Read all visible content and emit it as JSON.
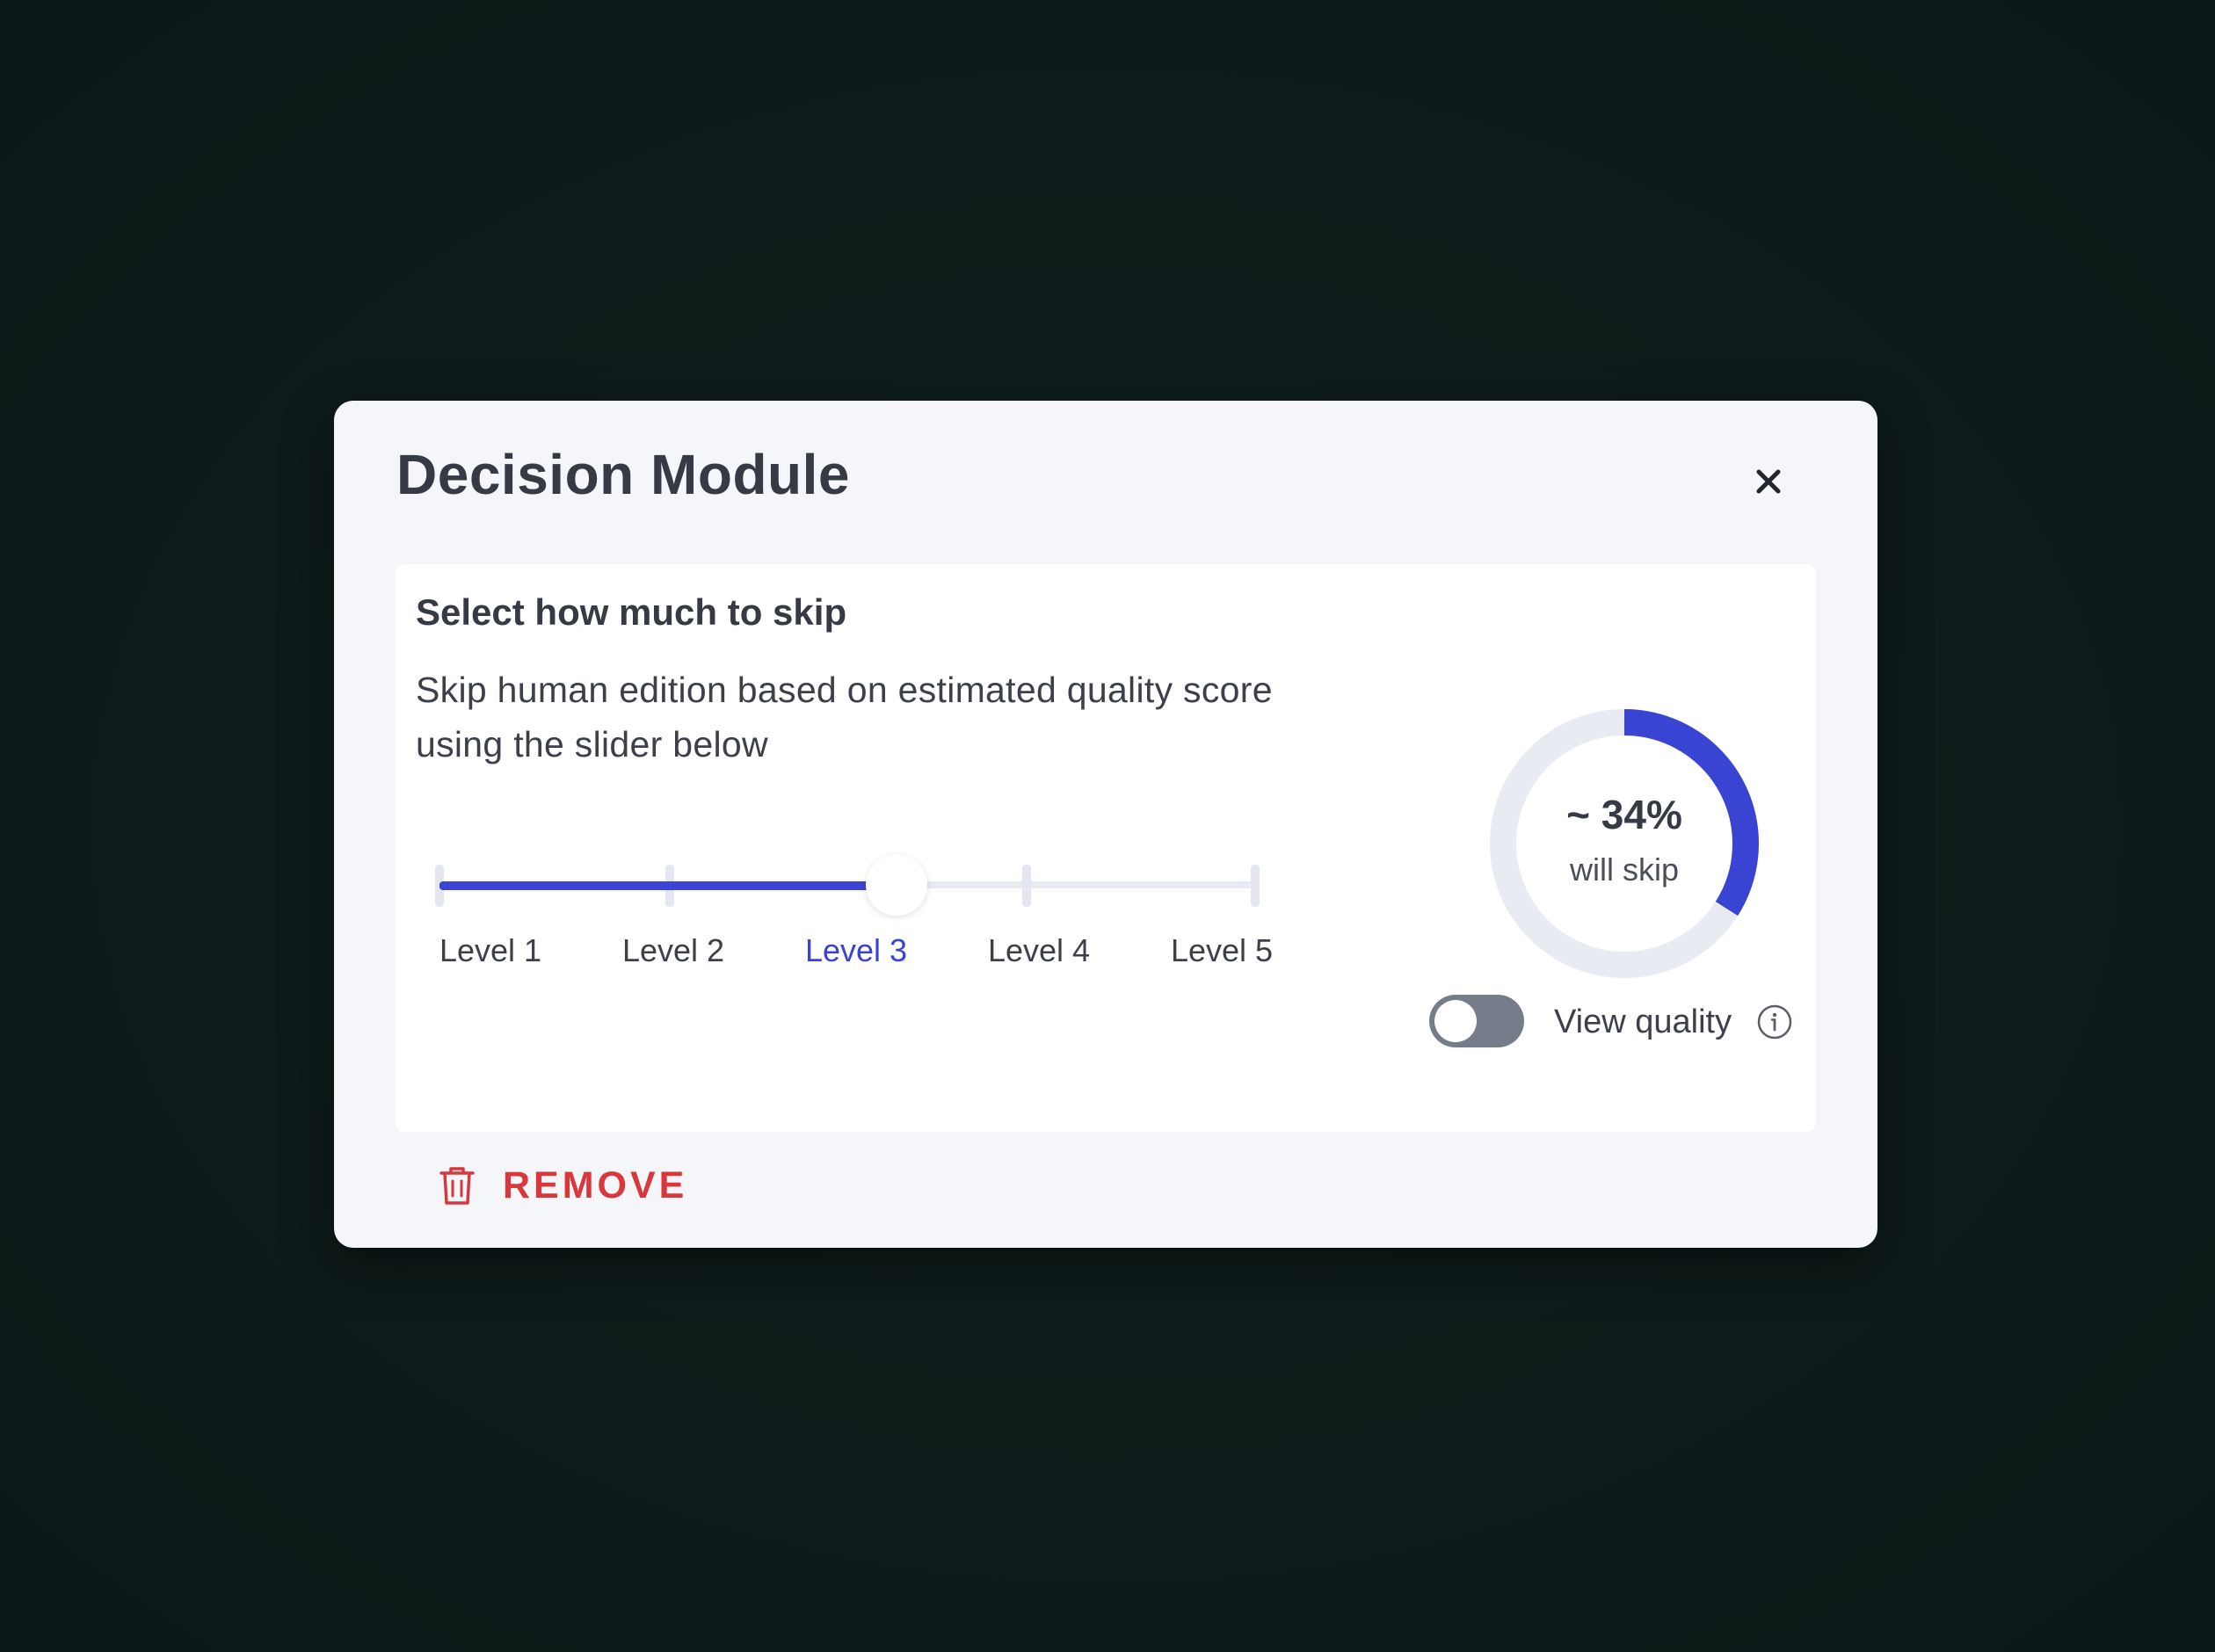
{
  "modal": {
    "title": "Decision Module",
    "close_label": "close"
  },
  "card": {
    "heading": "Select how much to skip",
    "description": "Skip human edition based on estimated quality score using the slider below"
  },
  "slider": {
    "levels": [
      "Level 1",
      "Level 2",
      "Level 3",
      "Level 4",
      "Level 5"
    ],
    "selected_index": 2,
    "accent_color": "#3a44d2"
  },
  "skip_estimate": {
    "value_text": "~ 34%",
    "caption": "will skip",
    "fraction": 0.34,
    "accent_color": "#3a44d2"
  },
  "view_quality": {
    "label": "View quality",
    "enabled": false
  },
  "remove": {
    "label": "REMOVE",
    "color": "#d8373c"
  }
}
